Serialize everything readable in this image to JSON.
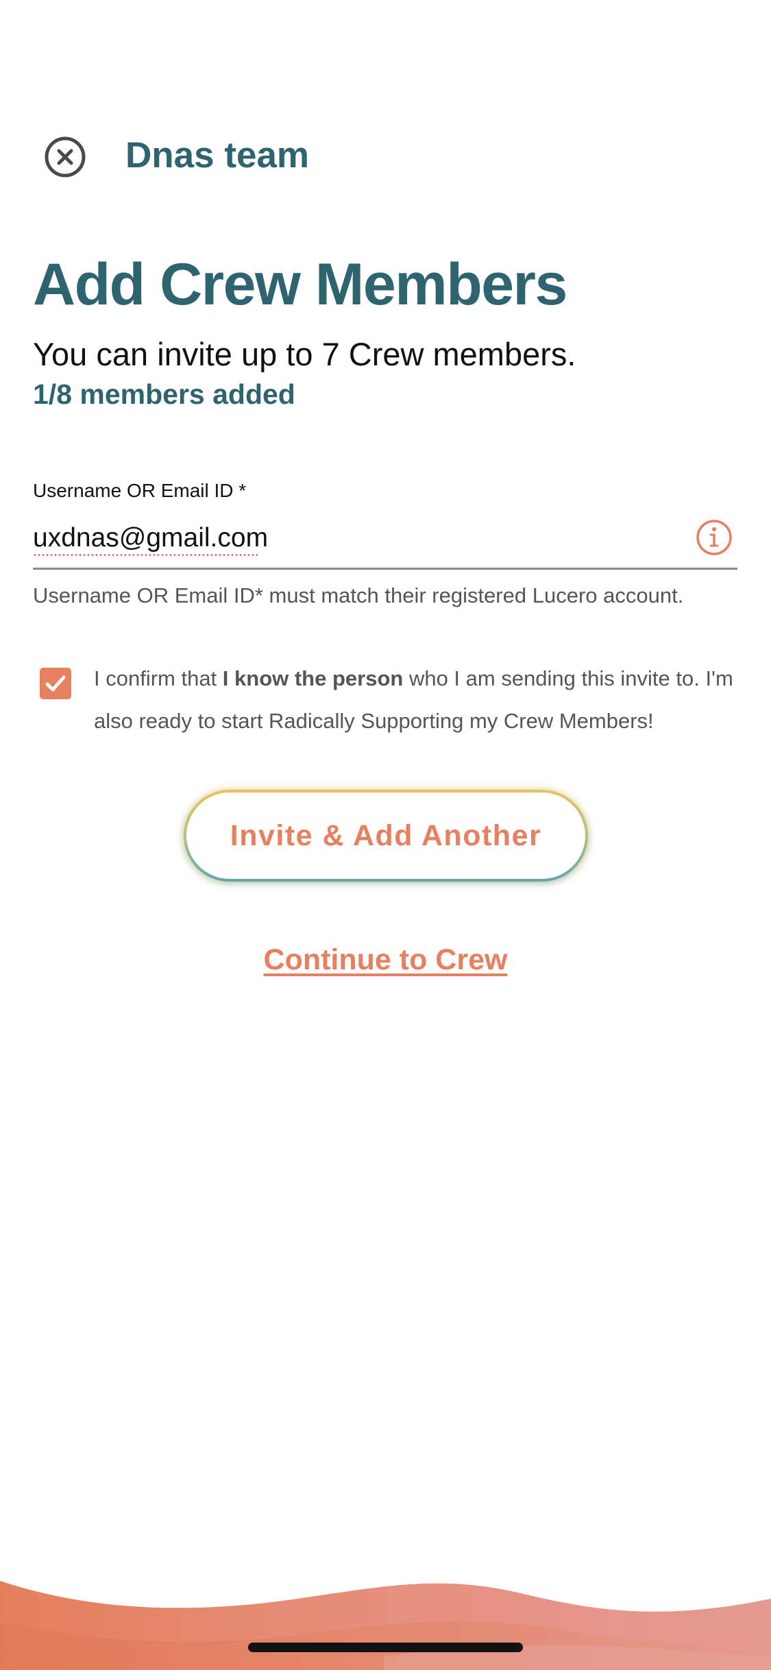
{
  "header": {
    "close_icon": "close-circle-icon",
    "team_name": "Dnas team"
  },
  "main": {
    "title": "Add Crew Members",
    "subtitle": "You can invite up to 7 Crew members.",
    "members_count": "1/8 members added"
  },
  "form": {
    "field_label": "Username OR Email ID *",
    "field_value": "uxdnas@gmail.com",
    "info_icon": "info-circle-icon",
    "helper_text": "Username OR Email ID* must match their registered Lucero account.",
    "confirm_checked": true,
    "confirm_prefix": "I confirm that ",
    "confirm_bold": "I know the person",
    "confirm_suffix": " who I am sending this invite to. I'm also ready to start Radically Supporting my Crew Members!"
  },
  "actions": {
    "invite_label": "Invite & Add Another",
    "continue_label": "Continue to Crew"
  },
  "colors": {
    "primary_teal": "#2d6470",
    "accent_coral": "#e6805f",
    "wave_coral": "#e3836b",
    "wave_pink": "#e5988f"
  }
}
